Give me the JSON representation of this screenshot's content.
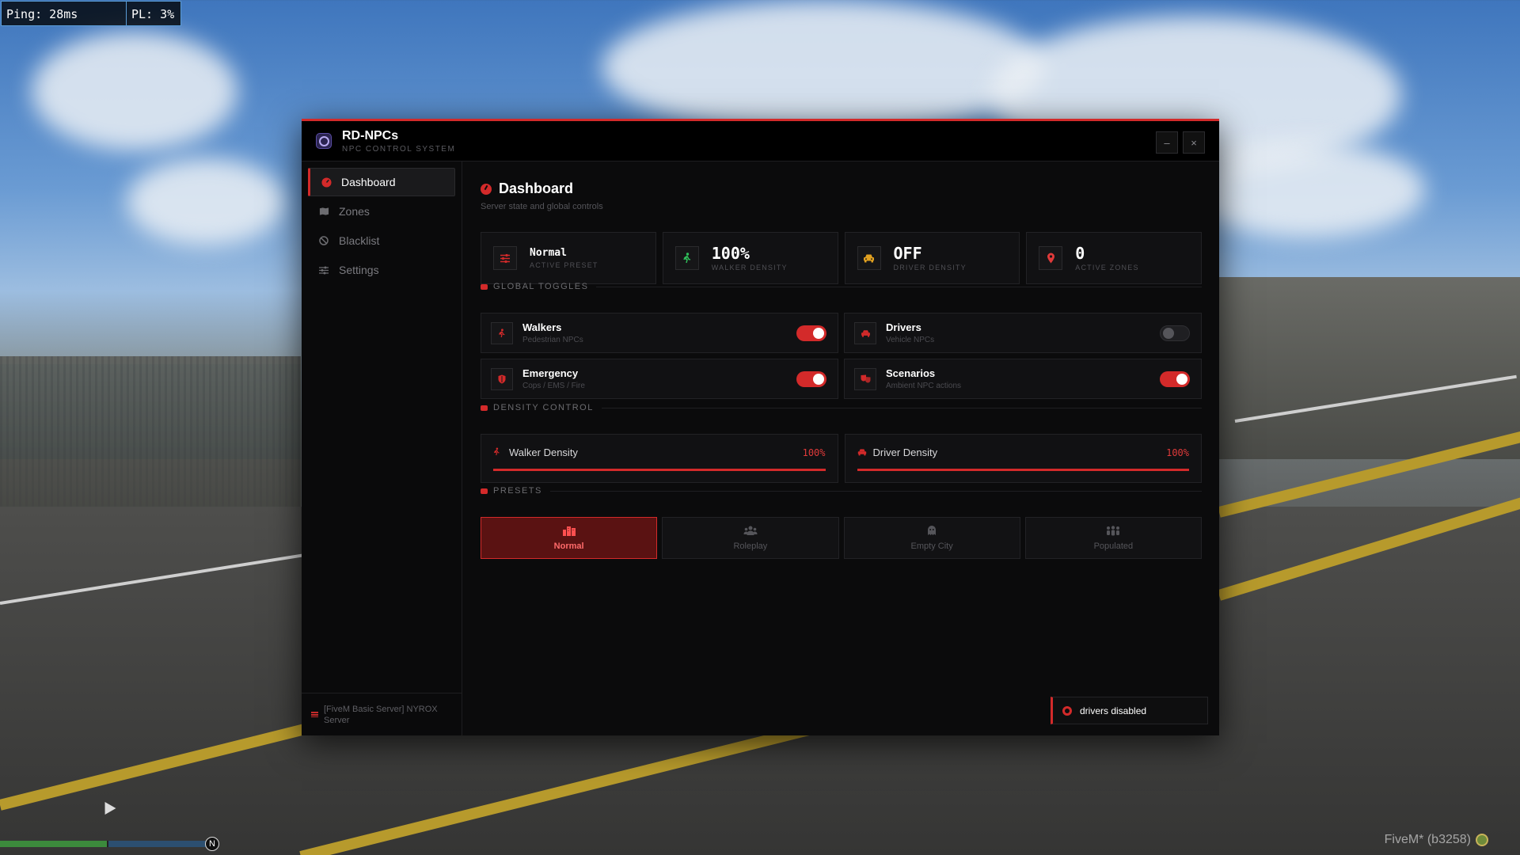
{
  "hud": {
    "ping": "Ping: 28ms",
    "packet_loss": "PL: 3%",
    "fivem_build": "FiveM* (b3258)",
    "compass": "N"
  },
  "window": {
    "title": "RD-NPCs",
    "subtitle": "NPC CONTROL SYSTEM",
    "minimize_label": "–",
    "close_label": "×",
    "accent_color": "#d32a2a"
  },
  "sidebar": {
    "items": [
      {
        "label": "Dashboard",
        "icon": "gauge-icon",
        "active": true
      },
      {
        "label": "Zones",
        "icon": "map-icon",
        "active": false
      },
      {
        "label": "Blacklist",
        "icon": "ban-icon",
        "active": false
      },
      {
        "label": "Settings",
        "icon": "sliders-icon",
        "active": false
      }
    ],
    "footer": "[FiveM Basic Server] NYROX Server"
  },
  "page": {
    "title": "Dashboard",
    "subtitle": "Server state and global controls"
  },
  "stats": [
    {
      "value": "Normal",
      "label": "ACTIVE PRESET",
      "icon": "sliders-icon",
      "color": "#d32a2a"
    },
    {
      "value": "100%",
      "label": "WALKER DENSITY",
      "icon": "walker-icon",
      "color": "#2fbf5a"
    },
    {
      "value": "OFF",
      "label": "DRIVER DENSITY",
      "icon": "car-icon",
      "color": "#e0a020"
    },
    {
      "value": "0",
      "label": "ACTIVE ZONES",
      "icon": "map-pin-icon",
      "color": "#e03a3a"
    }
  ],
  "sections": {
    "toggles": "GLOBAL TOGGLES",
    "density": "DENSITY CONTROL",
    "presets": "PRESETS"
  },
  "toggles": [
    {
      "title": "Walkers",
      "desc": "Pedestrian NPCs",
      "icon": "walker-icon",
      "on": true
    },
    {
      "title": "Drivers",
      "desc": "Vehicle NPCs",
      "icon": "car-icon",
      "on": false
    },
    {
      "title": "Emergency",
      "desc": "Cops / EMS / Fire",
      "icon": "shield-icon",
      "on": true
    },
    {
      "title": "Scenarios",
      "desc": "Ambient NPC actions",
      "icon": "masks-icon",
      "on": true
    }
  ],
  "density": [
    {
      "label": "Walker Density",
      "value": "100%",
      "level": 1.0,
      "icon": "walker-icon"
    },
    {
      "label": "Driver Density",
      "value": "100%",
      "level": 1.0,
      "icon": "car-icon"
    }
  ],
  "presets": [
    {
      "label": "Normal",
      "icon": "city-icon",
      "active": true
    },
    {
      "label": "Roleplay",
      "icon": "users-icon",
      "active": false
    },
    {
      "label": "Empty City",
      "icon": "ghost-icon",
      "active": false
    },
    {
      "label": "Populated",
      "icon": "crowd-icon",
      "active": false
    }
  ],
  "toast": {
    "message": "drivers disabled"
  }
}
